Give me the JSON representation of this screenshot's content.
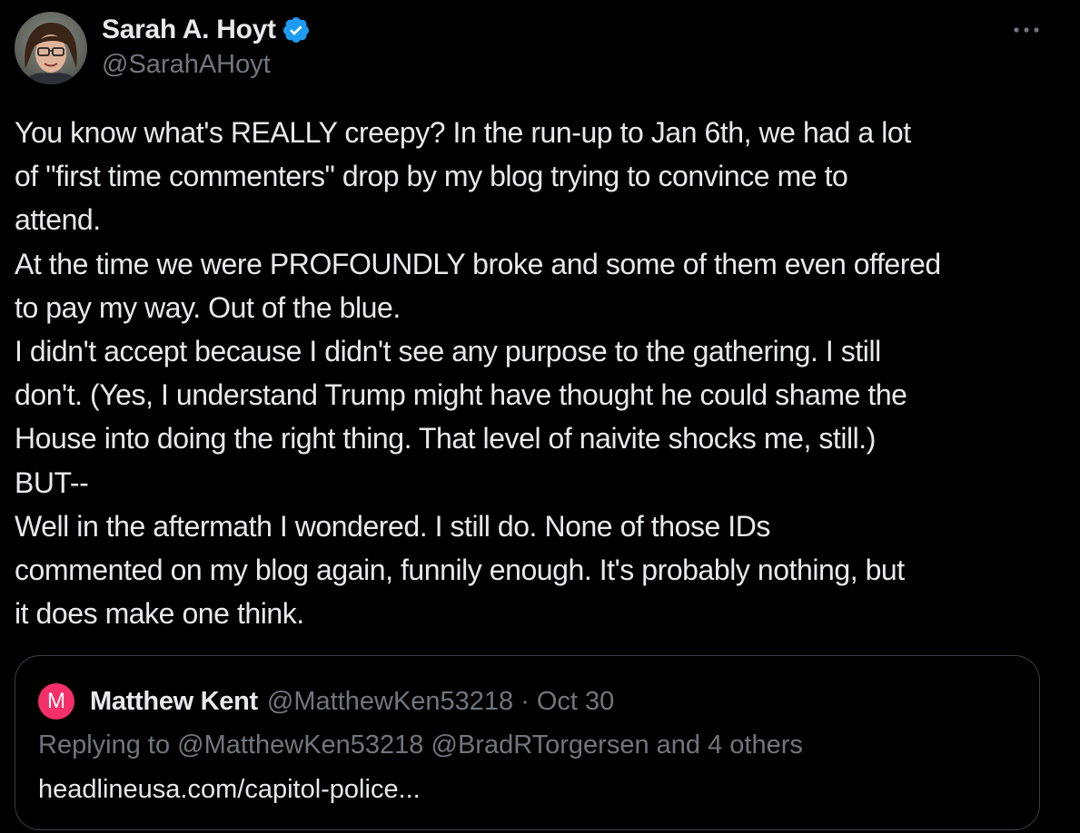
{
  "author": {
    "name": "Sarah A. Hoyt",
    "handle": "@SarahAHoyt",
    "verified": true,
    "avatar_icon": "profile-photo",
    "verified_icon": "verified-badge-icon",
    "verified_color": "#1d9bf0"
  },
  "more_icon": "more-horizontal-icon",
  "tweet": {
    "lines": [
      "You know what's REALLY creepy? In the run-up to Jan 6th, we had a lot",
      "of \"first time commenters\" drop by my blog trying to convince me to",
      "attend.",
      "At the time we were PROFOUNDLY broke and some of them even offered",
      "to pay my way. Out of the blue.",
      "I didn't accept because I didn't see any purpose to the gathering. I still",
      "don't. (Yes, I understand Trump might have thought he could shame the",
      "House into doing the right thing. That level of naivite shocks me, still.)",
      "BUT--",
      "Well in the aftermath I wondered. I still do. None of those IDs",
      "commented on my blog again, funnily enough. It's probably nothing, but",
      "it does make one think."
    ]
  },
  "quoted_tweet": {
    "avatar_letter": "M",
    "avatar_color": "#f4306a",
    "name": "Matthew Kent",
    "handle": "@MatthewKen53218",
    "separator": "·",
    "date": "Oct 30",
    "replying_prefix": "Replying to",
    "replying_mention_1": "@MatthewKen53218",
    "replying_mention_2": "@BradRTorgersen",
    "replying_suffix": "and 4 others",
    "link_text": "headlineusa.com/capitol-police..."
  },
  "colors": {
    "background": "#000000",
    "primary_text": "#e7e9ea",
    "secondary_text": "#71767b",
    "border": "#3b3f44"
  }
}
